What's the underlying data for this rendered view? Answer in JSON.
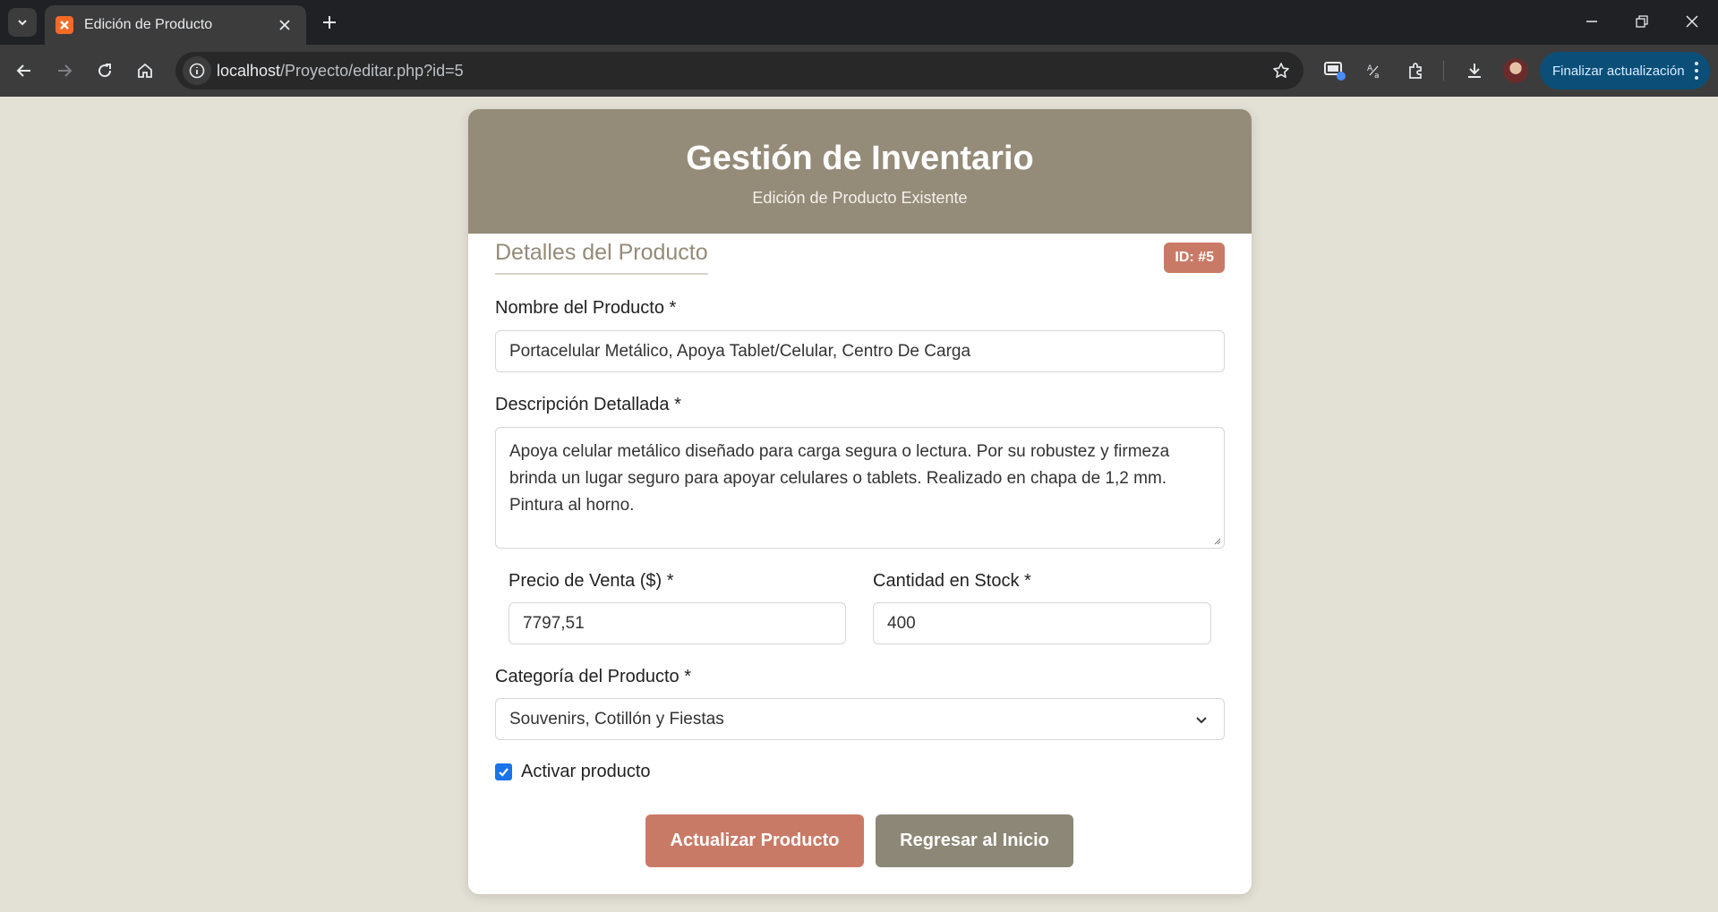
{
  "browser": {
    "tab_title": "Edición de Producto",
    "url_host": "localhost",
    "url_path": "/Proyecto/editar.php?id=5",
    "update_label": "Finalizar actualización",
    "favicon_icon": "xampp-icon"
  },
  "page": {
    "title": "Gestión de Inventario",
    "subtitle": "Edición de Producto Existente",
    "section_title": "Detalles del Producto",
    "id_badge": "ID: #5"
  },
  "form": {
    "name_label": "Nombre del Producto *",
    "name_value": "Portacelular Metálico, Apoya Tablet/Celular, Centro De Carga",
    "description_label": "Descripción Detallada *",
    "description_value": "Apoya celular metálico diseñado para carga segura o lectura. Por su robustez y firmeza brinda un lugar seguro para apoyar celulares o tablets. Realizado en chapa de 1,2 mm. Pintura al horno.",
    "price_label": "Precio de Venta ($) *",
    "price_value": "7797,51",
    "stock_label": "Cantidad en Stock *",
    "stock_value": "400",
    "category_label": "Categoría del Producto *",
    "category_value": "Souvenirs, Cotillón y Fiestas",
    "active_label": "Activar producto",
    "active_checked": true,
    "update_button": "Actualizar Producto",
    "back_button": "Regresar al Inicio"
  },
  "colors": {
    "header_bg": "#948b79",
    "primary_button": "#c97a66",
    "secondary_button": "#8c8776",
    "page_bg": "#e3e0d5"
  }
}
